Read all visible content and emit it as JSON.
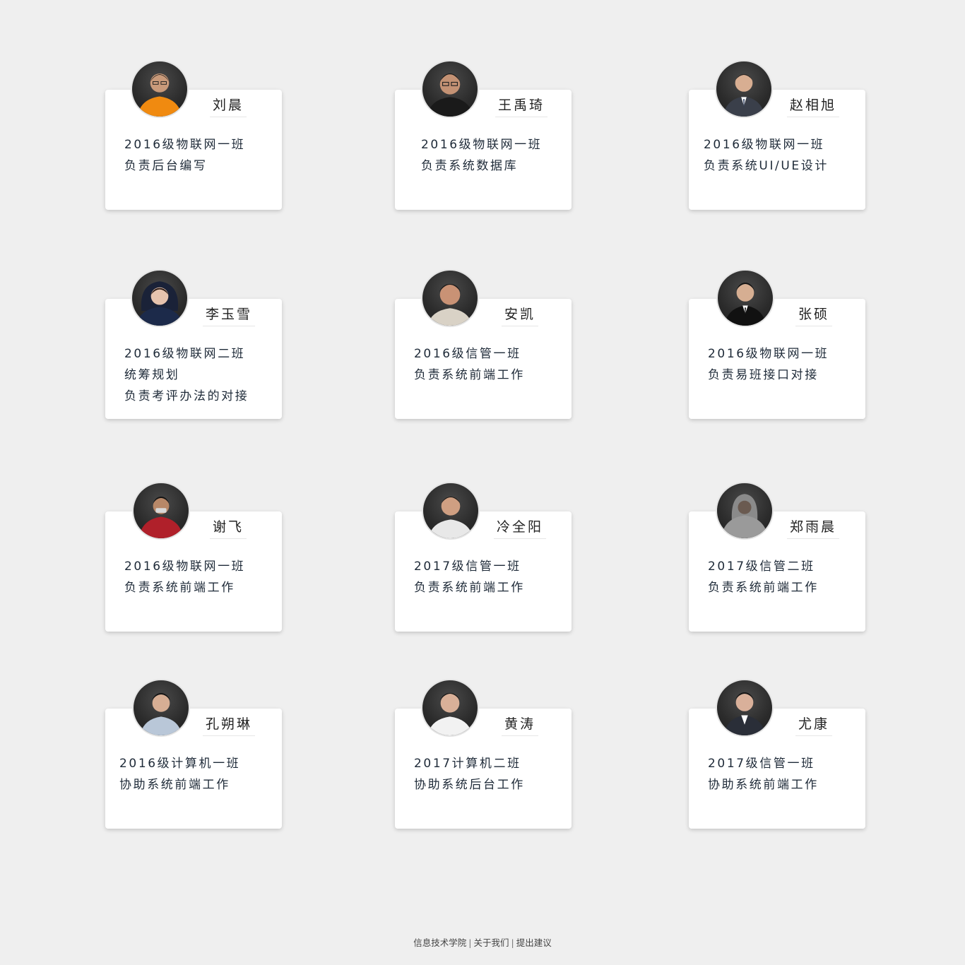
{
  "members": [
    {
      "name": "刘晨",
      "lines": [
        "2016级物联网一班",
        "负责后台编写"
      ],
      "shirt": "#f08a10"
    },
    {
      "name": "王禹琦",
      "lines": [
        "2016级物联网一班",
        "负责系统数据库"
      ],
      "shirt": "#1a1a1a"
    },
    {
      "name": "赵相旭",
      "lines": [
        "2016级物联网一班",
        "负责系统UI/UE设计"
      ],
      "shirt": "#3a3f4a"
    },
    {
      "name": "李玉雪",
      "lines": [
        "2016级物联网二班",
        "统筹规划",
        "负责考评办法的对接"
      ],
      "shirt": "#1c2a4a"
    },
    {
      "name": "安凯",
      "lines": [
        "2016级信管一班",
        "负责系统前端工作"
      ],
      "shirt": "#d9d2c6"
    },
    {
      "name": "张硕",
      "lines": [
        "2016级物联网一班",
        "负责易班接口对接"
      ],
      "shirt": "#111111"
    },
    {
      "name": "谢飞",
      "lines": [
        "2016级物联网一班",
        "负责系统前端工作"
      ],
      "shirt": "#b0202a"
    },
    {
      "name": "冷全阳",
      "lines": [
        "2017级信管一班",
        "负责系统前端工作"
      ],
      "shirt": "#e8e8e8"
    },
    {
      "name": "郑雨晨",
      "lines": [
        "2017级信管二班",
        "负责系统前端工作"
      ],
      "shirt": "#9a9a9a"
    },
    {
      "name": "孔朔琳",
      "lines": [
        "2016级计算机一班",
        "协助系统前端工作"
      ],
      "shirt": "#b9c7d8"
    },
    {
      "name": "黄涛",
      "lines": [
        "2017计算机二班",
        "协助系统后台工作"
      ],
      "shirt": "#f2f2f2"
    },
    {
      "name": "尤康",
      "lines": [
        "2017级信管一班",
        "协助系统前端工作"
      ],
      "shirt": "#2a2e38"
    }
  ],
  "footer": {
    "links": [
      "信息技术学院",
      "关于我们",
      "提出建议"
    ],
    "separator": "|"
  }
}
